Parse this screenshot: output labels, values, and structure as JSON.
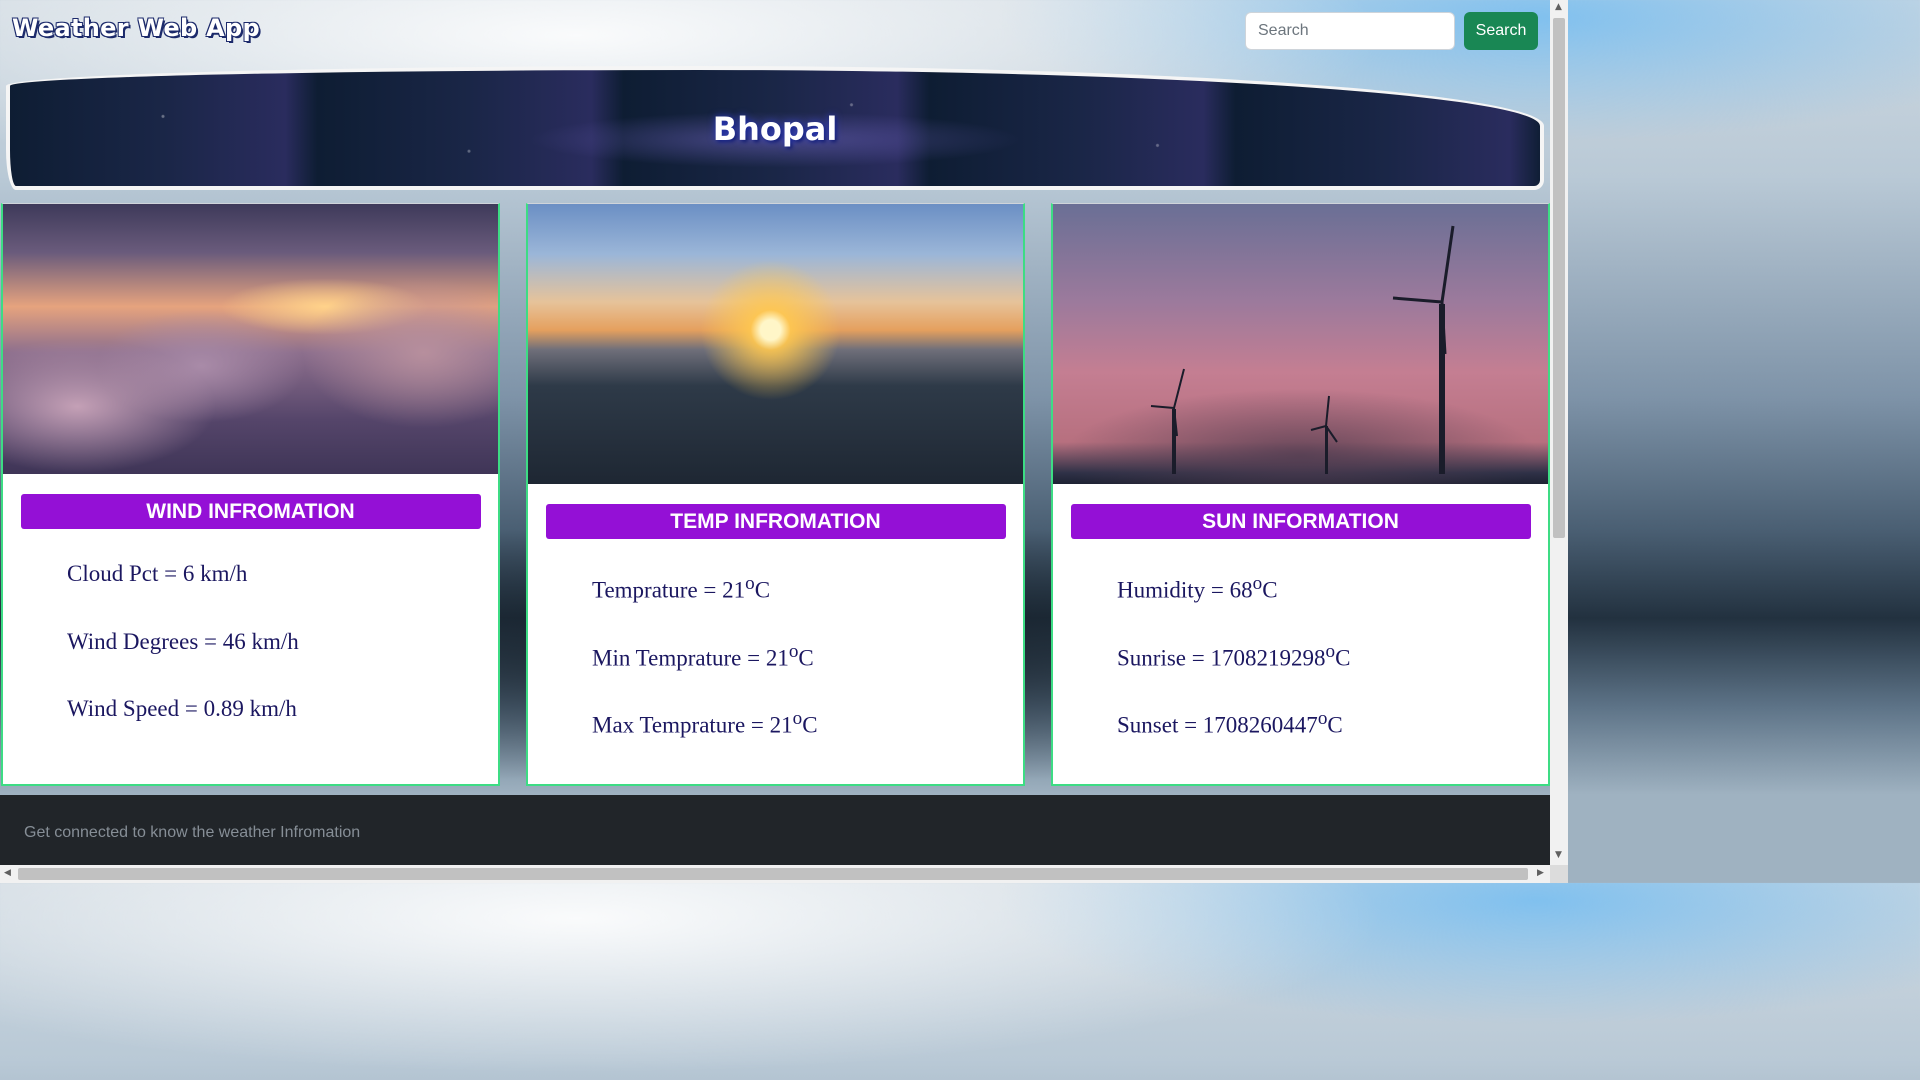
{
  "app": {
    "title": "Weather Web App"
  },
  "search": {
    "placeholder": "Search",
    "button_label": "Search"
  },
  "city": {
    "name": "Bhopal"
  },
  "cards": [
    {
      "header": "WIND INFROMATION",
      "image": "clouds-sunset-image",
      "items": [
        "Cloud Pct = 6 km/h",
        "Wind Degrees = 46 km/h",
        "Wind Speed = 0.89 km/h"
      ]
    },
    {
      "header": "TEMP INFROMATION",
      "image": "sea-sunset-image",
      "items": [
        {
          "text": "Temprature = 21",
          "sup": "o",
          "unit": "C"
        },
        {
          "text": "Min Temprature = 21",
          "sup": "o",
          "unit": "C"
        },
        {
          "text": "Max Temprature = 21",
          "sup": "o",
          "unit": "C"
        }
      ]
    },
    {
      "header": "SUN INFORMATION",
      "image": "wind-turbines-image",
      "items": [
        {
          "text": "Humidity = 68",
          "sup": "o",
          "unit": "C"
        },
        {
          "text": "Sunrise = 1708219298",
          "sup": "o",
          "unit": "C"
        },
        {
          "text": "Sunset = 1708260447",
          "sup": "o",
          "unit": "C"
        }
      ]
    }
  ],
  "footer": {
    "text": "Get connected to know the weather Infromation"
  },
  "colors": {
    "header_purple": "#9410d6",
    "search_green": "#198754",
    "card_border": "#3ddc84",
    "footer_bg": "#212529"
  }
}
